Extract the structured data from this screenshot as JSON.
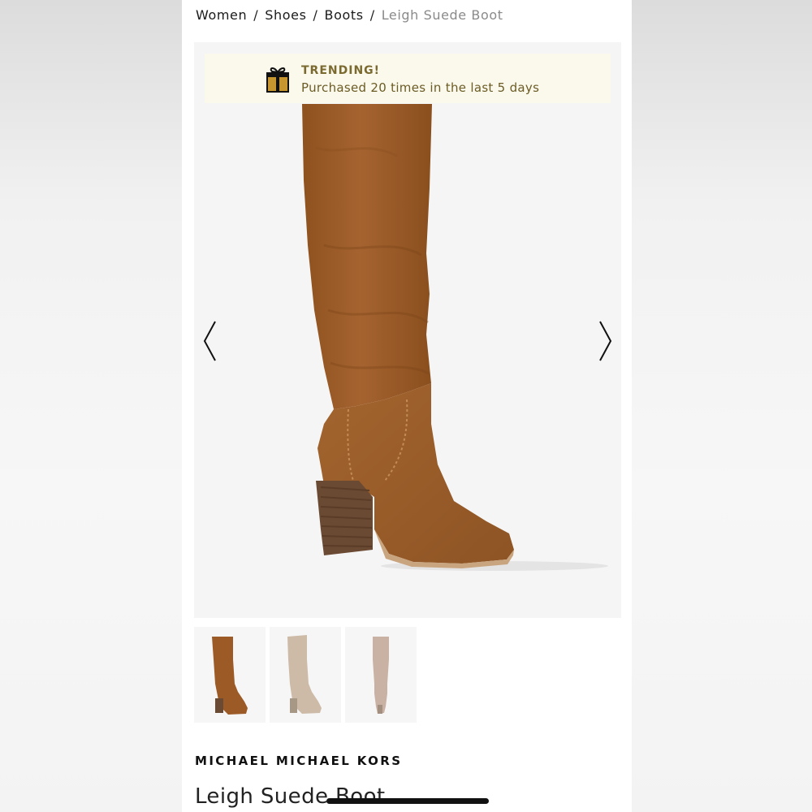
{
  "breadcrumb": {
    "items": [
      "Women",
      "Shoes",
      "Boots"
    ],
    "current": "Leigh Suede Boot",
    "separator": "/"
  },
  "trending": {
    "title": "TRENDING!",
    "message": "Purchased 20 times in the last 5 days",
    "icon": "gift-icon"
  },
  "gallery": {
    "prev_icon": "chevron-left-icon",
    "next_icon": "chevron-right-icon",
    "image_count": 3
  },
  "thumbnails": [
    {
      "color_name": "brown",
      "hex": "#9b5a26"
    },
    {
      "color_name": "light-taupe",
      "hex": "#cdbba7"
    },
    {
      "color_name": "taupe",
      "hex": "#c9b2a3"
    }
  ],
  "product": {
    "brand": "MICHAEL MICHAEL KORS",
    "name": "Leigh Suede Boot"
  },
  "colors": {
    "trend_bg": "#fbf8ec",
    "trend_text": "#7a6a30",
    "boot_main": "#9b5a26",
    "heel": "#6b4a33"
  }
}
